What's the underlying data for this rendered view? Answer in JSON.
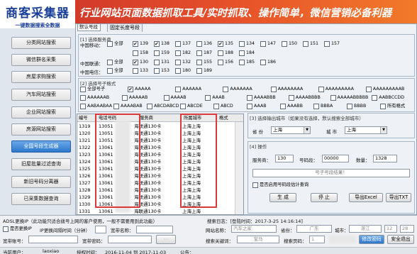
{
  "app": {
    "logo_title": "商客采集器",
    "logo_subtitle": "一键数据搜索全数据",
    "banner": "行业网站页面数据抓取工具/实时抓取、操作简单，微信营销必备利器"
  },
  "sidebar": {
    "items": [
      "分类网站搜索",
      "微信群名采集",
      "房屋求购搜索",
      "汽车网站搜索",
      "企业网站搜索",
      "房源网站搜索",
      "全国号段生成器",
      "旧屋批量过滤查询",
      "新旧号码分离器",
      "已采集数据查询"
    ],
    "active_index": 6
  },
  "tabs": [
    "默认号段",
    "固定长度号段"
  ],
  "carrier_group": {
    "title": "[1] 选择服务商",
    "rows": [
      {
        "label": "中国移动：",
        "all": "全部",
        "numbers": [
          {
            "n": "139",
            "c": true
          },
          {
            "n": "138",
            "c": true
          },
          {
            "n": "137",
            "c": false
          },
          {
            "n": "136",
            "c": false
          },
          {
            "n": "135",
            "c": true
          },
          {
            "n": "134",
            "c": false
          },
          {
            "n": "147",
            "c": false
          },
          {
            "n": "150",
            "c": false
          },
          {
            "n": "151",
            "c": false
          },
          {
            "n": "157",
            "c": false
          },
          {
            "n": "158",
            "c": false
          },
          {
            "n": "159",
            "c": false
          },
          {
            "n": "182",
            "c": false
          },
          {
            "n": "187",
            "c": false
          },
          {
            "n": "188",
            "c": false
          },
          {
            "n": "184",
            "c": false
          }
        ]
      },
      {
        "label": "中国联通：",
        "all": "全部",
        "numbers": [
          {
            "n": "130",
            "c": true
          },
          {
            "n": "131",
            "c": false
          },
          {
            "n": "132",
            "c": false
          },
          {
            "n": "155",
            "c": false
          },
          {
            "n": "156",
            "c": false
          },
          {
            "n": "185",
            "c": false
          },
          {
            "n": "186",
            "c": false
          }
        ]
      },
      {
        "label": "中国电信：",
        "all": "全部",
        "numbers": [
          {
            "n": "133",
            "c": false
          },
          {
            "n": "153",
            "c": false
          },
          {
            "n": "180",
            "c": false
          },
          {
            "n": "189",
            "c": false
          }
        ]
      }
    ]
  },
  "format_group": {
    "title": "[2] 选择号子格式",
    "options": [
      {
        "t": "全部号子",
        "c": false
      },
      {
        "t": "AAAAA",
        "c": true
      },
      {
        "t": "AAAAAA",
        "c": false
      },
      {
        "t": "AAAAAAA",
        "c": false
      },
      {
        "t": "AAAAAAAA",
        "c": false
      },
      {
        "t": "AAAAAAAAA",
        "c": false
      },
      {
        "t": "AAAAAAAAAB",
        "c": false
      },
      {
        "t": "AAAAAAB",
        "c": false
      },
      {
        "t": "AAAAAB",
        "c": false
      },
      {
        "t": "AAAAB",
        "c": false
      },
      {
        "t": "AAAB",
        "c": false
      },
      {
        "t": "AAAABBB",
        "c": false
      },
      {
        "t": "AAAABBBB",
        "c": false
      },
      {
        "t": "AAAAABBBBB",
        "c": false
      },
      {
        "t": "AABBCCDD",
        "c": false
      },
      {
        "t": "AABAABAA",
        "c": false
      },
      {
        "t": "AAAABAB",
        "c": false
      },
      {
        "t": "ABCDABCD",
        "c": false
      },
      {
        "t": "ABCDE",
        "c": false
      },
      {
        "t": "ABCD",
        "c": false
      },
      {
        "t": "AAAB",
        "c": false
      },
      {
        "t": "AAABB",
        "c": false
      },
      {
        "t": "BBBA",
        "c": false
      },
      {
        "t": "BBBB",
        "c": false
      },
      {
        "t": "所有格式",
        "c": false
      }
    ]
  },
  "table": {
    "headers": [
      "编号",
      "电话号码",
      "服务商",
      "所属城市",
      "格式"
    ],
    "rows": [
      {
        "id": "1319",
        "phone": "13051",
        "carrier": "海联通130卡",
        "city": "上海上海",
        "fmt": ""
      },
      {
        "id": "1320",
        "phone": "13051",
        "carrier": "海联通130卡",
        "city": "上海上海",
        "fmt": ""
      },
      {
        "id": "1321",
        "phone": "13051",
        "carrier": "海联通130卡",
        "city": "上海上海",
        "fmt": ""
      },
      {
        "id": "1322",
        "phone": "13061",
        "carrier": "海联通130卡",
        "city": "上海上海",
        "fmt": ""
      },
      {
        "id": "1323",
        "phone": "13061",
        "carrier": "海联通130卡",
        "city": "上海上海",
        "fmt": ""
      },
      {
        "id": "1324",
        "phone": "13061",
        "carrier": "海联通130卡",
        "city": "上海上海",
        "fmt": ""
      },
      {
        "id": "1325",
        "phone": "13061",
        "carrier": "海联通130卡",
        "city": "上海上海",
        "fmt": ""
      },
      {
        "id": "1326",
        "phone": "13061",
        "carrier": "海联通130卡",
        "city": "上海上海",
        "fmt": ""
      },
      {
        "id": "1327",
        "phone": "13061",
        "carrier": "海联通130卡",
        "city": "上海上海",
        "fmt": ""
      },
      {
        "id": "1328",
        "phone": "13061",
        "carrier": "海联通130卡",
        "city": "上海上海",
        "fmt": ""
      },
      {
        "id": "1329",
        "phone": "13061",
        "carrier": "海联通130卡",
        "city": "上海上海",
        "fmt": ""
      },
      {
        "id": "1330",
        "phone": "13061",
        "carrier": "海联通130卡",
        "city": "上海上海",
        "fmt": ""
      },
      {
        "id": "1331",
        "phone": "13061",
        "carrier": "海联通130卡",
        "city": "上海上海",
        "fmt": ""
      }
    ]
  },
  "city_group": {
    "title": "[3] 选择输出城市（如果没有选择，默认搜索全部城市）",
    "province_label": "省 份",
    "province_value": "上海",
    "city_label": "城 市",
    "city_value": "上海"
  },
  "operate_group": {
    "title": "[4] 操作",
    "service_label": "服务商：",
    "service_value": "130",
    "seg_label": "号码段：",
    "seg_value": "00000",
    "qty_label": "数量：",
    "qty_value": "1328",
    "result_placeholder": "号子号段结果！",
    "checkbox_label": "是否启用号码段估计查询",
    "buttons": [
      "生 成",
      "停 止",
      "导出Excel",
      "导出TXT"
    ]
  },
  "bottom": {
    "adsl_title": "ADSL更换IP（此功能只适合拨号上网的客户使用，一般不需要用到此功能）",
    "change_ip_label": "是否更换IP",
    "interval_label": "IP更换间隔时间（分钟）",
    "broadband_name_label": "宽带名称：",
    "broadband_account_label": "宽带账号：",
    "broadband_pwd_label": "宽带密码：",
    "search_log": "搜索日志：[登陆时间：2017-3-25 14:16:14]",
    "site_label": "网站名称：",
    "site_value": "汽车之家",
    "province_label": "省份：",
    "province_value": "广东",
    "city_label": "城市：",
    "city_value": "湛江",
    "num": "12",
    "pages": "28",
    "search_key_label": "搜索关键词：",
    "search_key_value": "宝马",
    "search_page_label": "搜索页码：",
    "search_page_value": "1",
    "status_btn": "修改密码",
    "status_btn2": "安全退出"
  },
  "status": {
    "user_label": "当前用户：",
    "user": "laoxiao",
    "auth_label": "授权时间：",
    "auth": "2016-11-04 到 2017-11-03",
    "notice_label": "公告："
  }
}
